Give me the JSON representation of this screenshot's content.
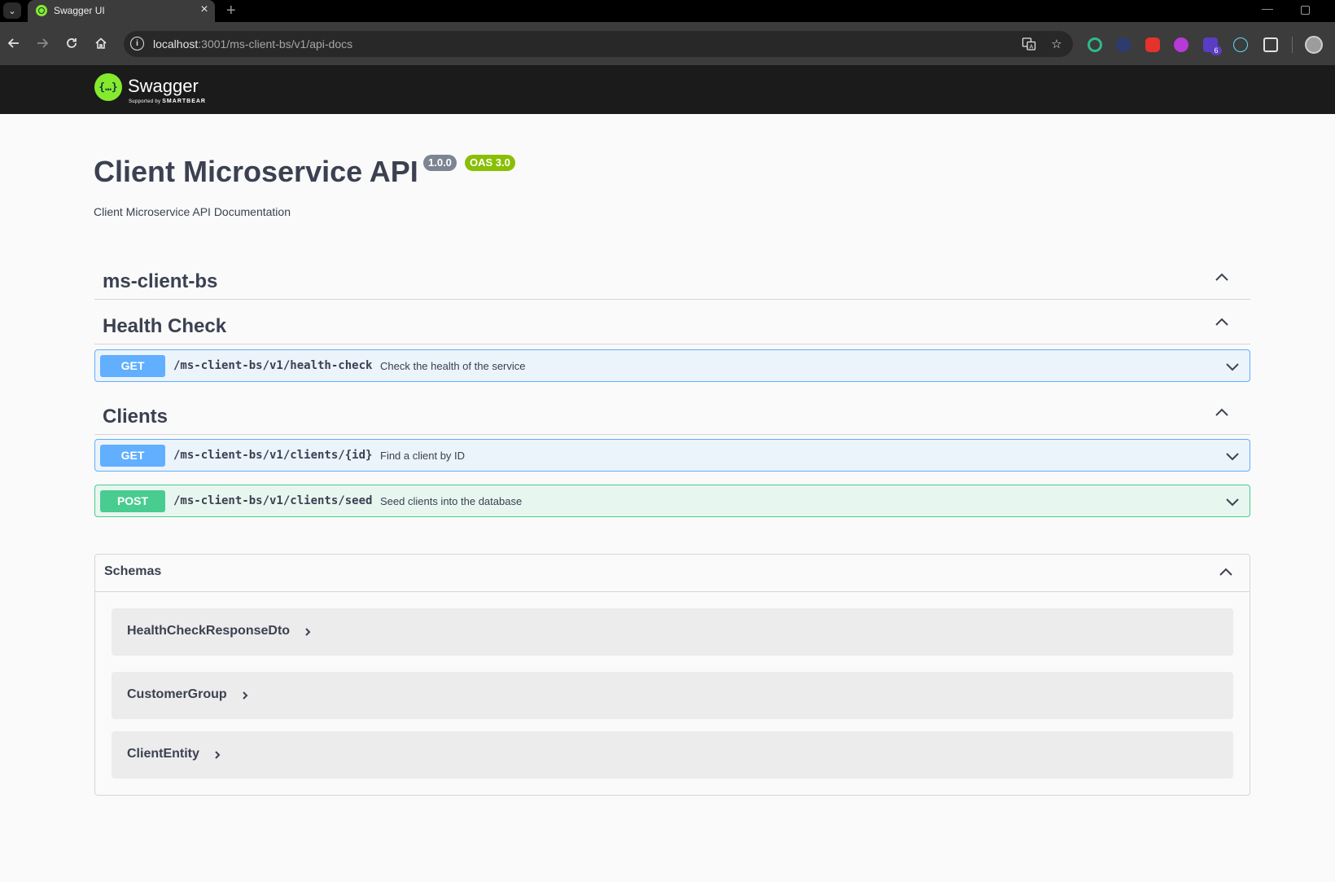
{
  "browser": {
    "tab_title": "Swagger UI",
    "tab_close": "×",
    "new_tab": "+",
    "url_host": "localhost",
    "url_rest": ":3001/ms-client-bs/v1/api-docs",
    "extension_badge": "6"
  },
  "swagger": {
    "brand": "Swagger",
    "sub_prefix": "Supported by",
    "sub_brand": "SMARTBEAR",
    "logo_glyph": "{…}"
  },
  "info": {
    "title": "Client Microservice API",
    "version": "1.0.0",
    "oas": "OAS 3.0",
    "description": "Client Microservice API Documentation"
  },
  "tags": [
    {
      "name": "ms-client-bs",
      "operations": []
    },
    {
      "name": "Health Check",
      "operations": [
        {
          "method": "GET",
          "path": "/ms-client-bs/v1/health-check",
          "summary": "Check the health of the service"
        }
      ]
    },
    {
      "name": "Clients",
      "operations": [
        {
          "method": "GET",
          "path": "/ms-client-bs/v1/clients/{id}",
          "summary": "Find a client by ID"
        },
        {
          "method": "POST",
          "path": "/ms-client-bs/v1/clients/seed",
          "summary": "Seed clients into the database"
        }
      ]
    }
  ],
  "schemas": {
    "title": "Schemas",
    "models": [
      "HealthCheckResponseDto",
      "CustomerGroup",
      "ClientEntity"
    ]
  },
  "colors": {
    "get": "#61affe",
    "post": "#49cc90",
    "swagger_green": "#85ea2d",
    "text": "#3b4151"
  }
}
